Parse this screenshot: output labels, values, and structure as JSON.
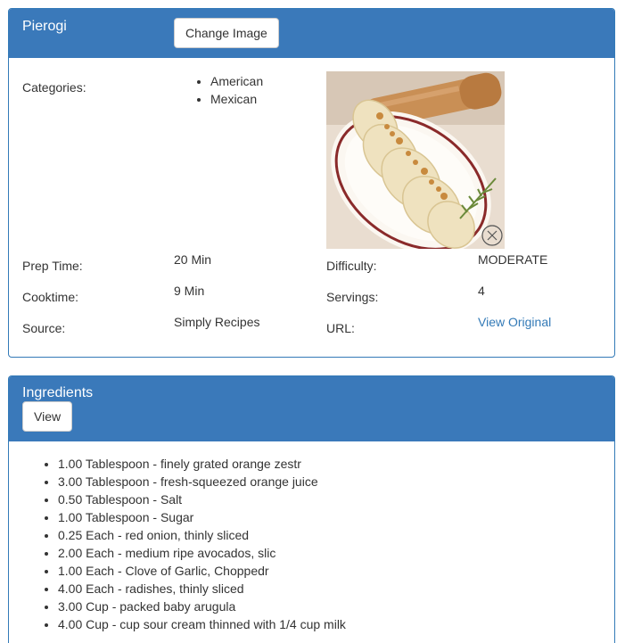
{
  "recipe": {
    "title": "Pierogi",
    "change_image_label": "Change Image",
    "categories_label": "Categories:",
    "categories": [
      "American",
      "Mexican"
    ],
    "image_alt": "Pierogi dumplings on a plate",
    "prep_time_label": "Prep Time:",
    "prep_time_value": "20 Min",
    "difficulty_label": "Difficulty:",
    "difficulty_value": "MODERATE",
    "cooktime_label": "Cooktime:",
    "cooktime_value": "9 Min",
    "servings_label": "Servings:",
    "servings_value": "4",
    "source_label": "Source:",
    "source_value": "Simply Recipes",
    "url_label": "URL:",
    "url_link_text": "View Original"
  },
  "ingredients": {
    "title": "Ingredients",
    "view_label": "View",
    "items": [
      "1.00 Tablespoon - finely grated orange zestr",
      "3.00 Tablespoon - fresh-squeezed orange juice",
      "0.50 Tablespoon - Salt",
      "1.00 Tablespoon - Sugar",
      "0.25 Each - red onion, thinly sliced",
      "2.00 Each - medium ripe avocados, slic",
      "1.00 Each - Clove of Garlic, Choppedr",
      "4.00 Each - radishes, thinly sliced",
      "3.00 Cup - packed baby arugula",
      "4.00 Cup - cup sour cream thinned with 1/4 cup milk"
    ]
  },
  "colors": {
    "panel_heading": "#3a79ba",
    "link": "#337ab7"
  }
}
